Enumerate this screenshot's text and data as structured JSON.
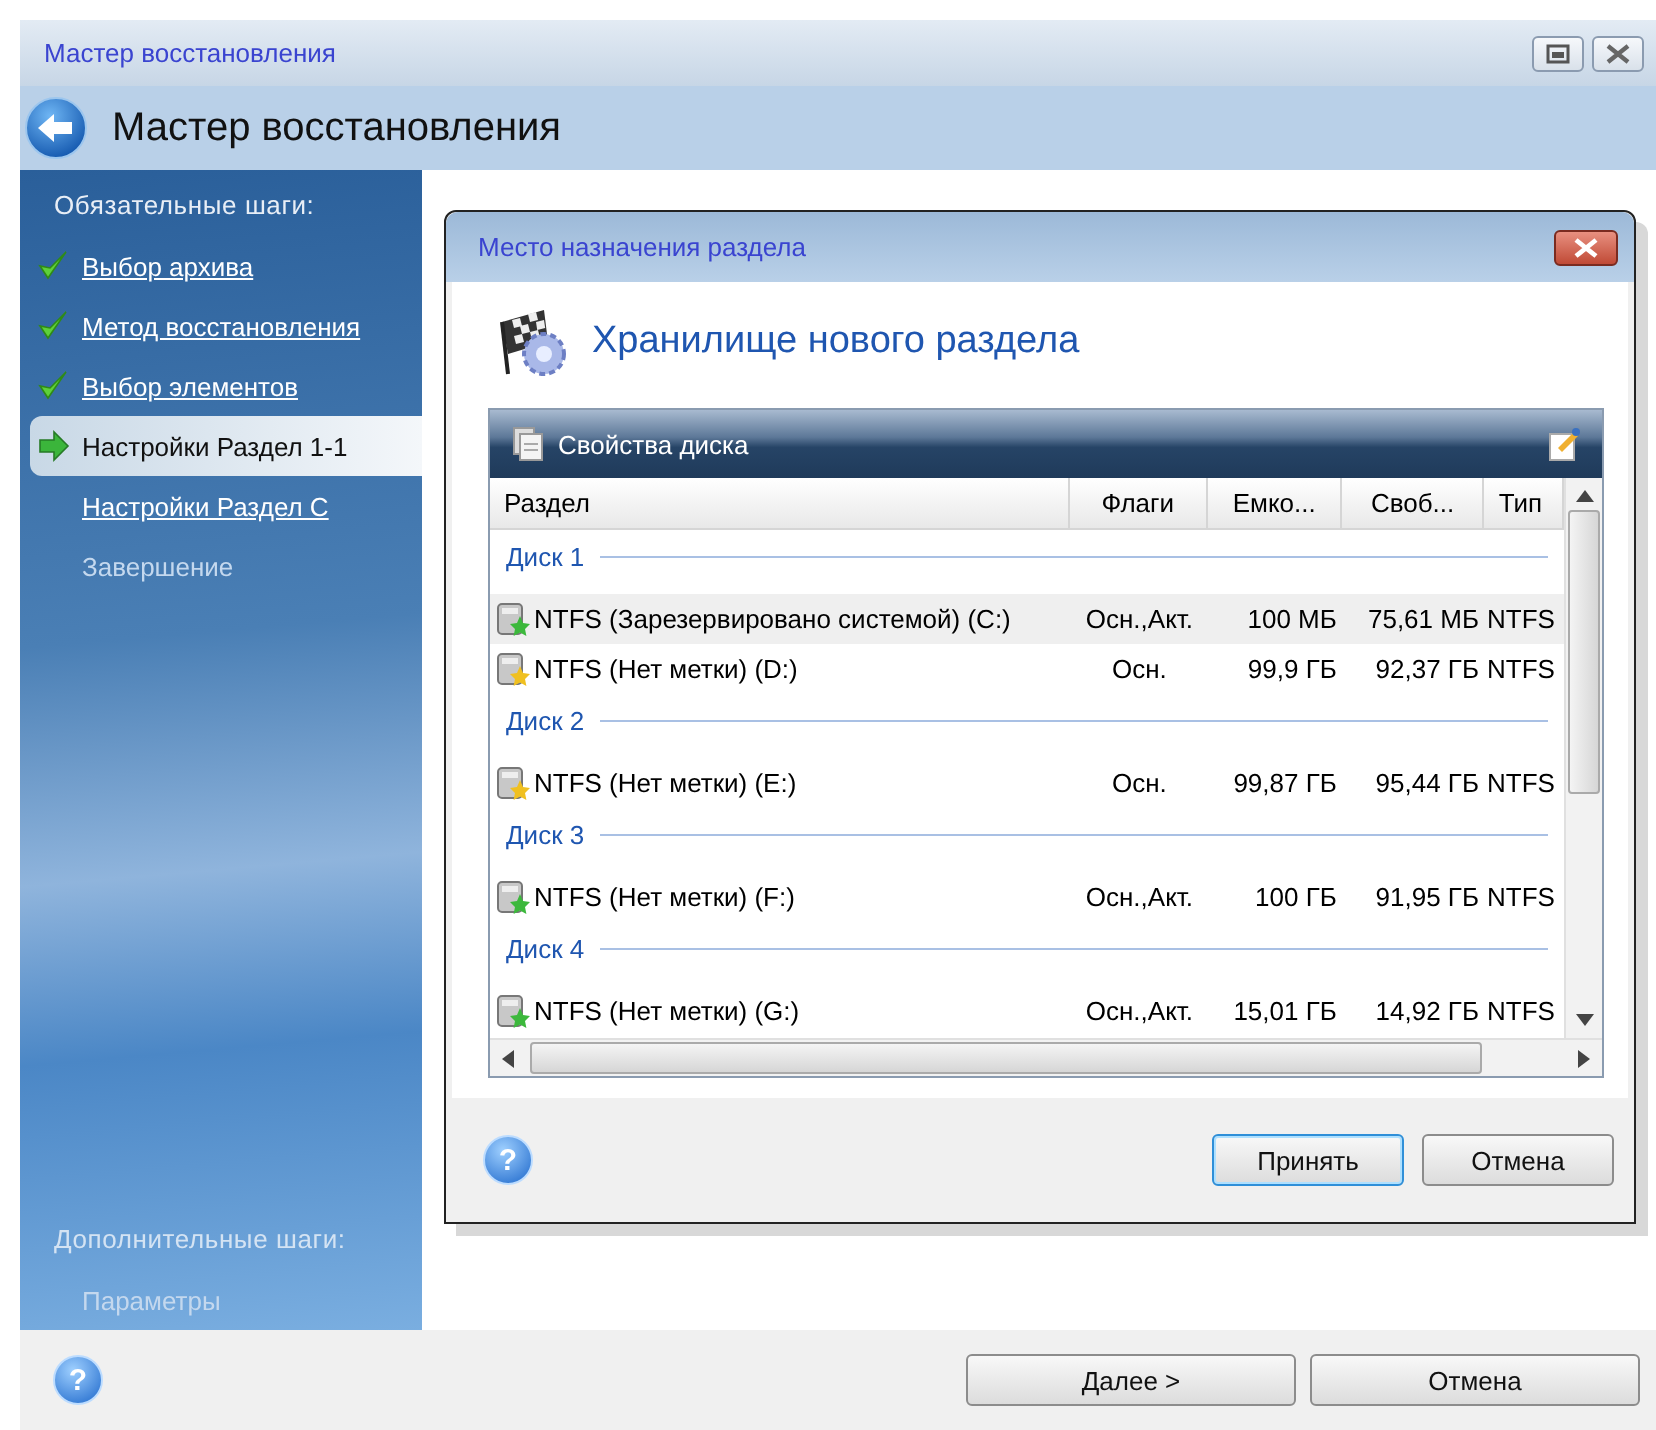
{
  "window": {
    "title": "Мастер восстановления"
  },
  "header": {
    "title": "Мастер восстановления"
  },
  "sidebar": {
    "required_heading": "Обязательные шаги:",
    "items": [
      {
        "label": "Выбор архива",
        "kind": "done",
        "selected": false
      },
      {
        "label": "Метод восстановления",
        "kind": "done",
        "selected": false
      },
      {
        "label": "Выбор элементов",
        "kind": "done",
        "selected": false
      },
      {
        "label": "Настройки Раздел 1-1",
        "kind": "current",
        "selected": true
      },
      {
        "label": "Настройки Раздел C",
        "kind": "link",
        "selected": false
      },
      {
        "label": "Завершение",
        "kind": "disabled",
        "selected": false
      }
    ],
    "optional_heading": "Дополнительные шаги:",
    "optional_items": [
      {
        "label": "Параметры",
        "kind": "disabled",
        "selected": false
      }
    ]
  },
  "dialog": {
    "title": "Место назначения раздела",
    "heading": "Хранилище нового раздела",
    "panel_title": "Свойства диска",
    "columns": [
      "Раздел",
      "Флаги",
      "Емко...",
      "Своб...",
      "Тип"
    ],
    "disks": [
      {
        "name": "Диск 1",
        "partitions": [
          {
            "partition": "NTFS (Зарезервировано системой) (C:)",
            "flags": "Осн.,Акт.",
            "capacity": "100 МБ",
            "free": "75,61 МБ",
            "type": "NTFS",
            "color": "#3cb83c",
            "selected": true
          },
          {
            "partition": "NTFS (Нет метки) (D:)",
            "flags": "Осн.",
            "capacity": "99,9 ГБ",
            "free": "92,37 ГБ",
            "type": "NTFS",
            "color": "#f0c020",
            "selected": false
          }
        ]
      },
      {
        "name": "Диск 2",
        "partitions": [
          {
            "partition": "NTFS (Нет метки) (E:)",
            "flags": "Осн.",
            "capacity": "99,87 ГБ",
            "free": "95,44 ГБ",
            "type": "NTFS",
            "color": "#f0c020",
            "selected": false
          }
        ]
      },
      {
        "name": "Диск 3",
        "partitions": [
          {
            "partition": "NTFS (Нет метки) (F:)",
            "flags": "Осн.,Акт.",
            "capacity": "100 ГБ",
            "free": "91,95 ГБ",
            "type": "NTFS",
            "color": "#3cb83c",
            "selected": false
          }
        ]
      },
      {
        "name": "Диск 4",
        "partitions": [
          {
            "partition": "NTFS (Нет метки) (G:)",
            "flags": "Осн.,Акт.",
            "capacity": "15,01 ГБ",
            "free": "14,92 ГБ",
            "type": "NTFS",
            "color": "#3cb83c",
            "selected": false
          }
        ]
      }
    ],
    "buttons": [
      {
        "label": "Принять",
        "default": true
      },
      {
        "label": "Отмена",
        "default": false
      }
    ],
    "help": {
      "label": "?"
    }
  },
  "buttons": [
    {
      "label": "Далее >",
      "default": false
    },
    {
      "label": "Отмена",
      "default": false
    }
  ],
  "help": {
    "label": "?"
  }
}
